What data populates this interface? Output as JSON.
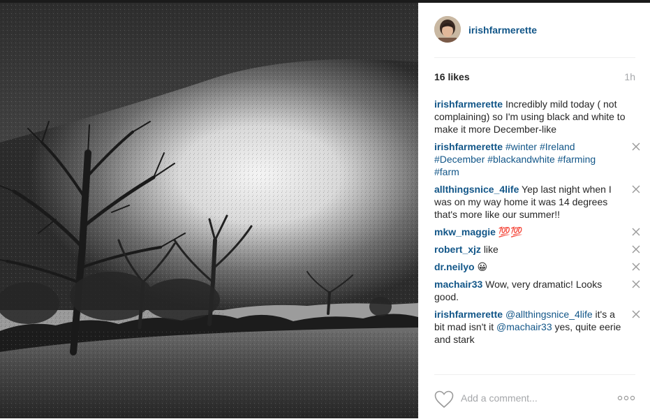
{
  "post": {
    "owner": "irishfarmerette",
    "likes": "16 likes",
    "time_ago": "1h"
  },
  "caption": {
    "user": "irishfarmerette",
    "text": "Incredibly mild today ( not complaining) so I'm using black and white to make it more December-like"
  },
  "comments": [
    {
      "user": "irishfarmerette",
      "parts": [
        {
          "t": "#winter",
          "tag": true
        },
        {
          "t": " "
        },
        {
          "t": "#Ireland",
          "tag": true
        },
        {
          "t": " "
        },
        {
          "t": "#December",
          "tag": true
        },
        {
          "t": " "
        },
        {
          "t": "#blackandwhite",
          "tag": true
        },
        {
          "t": " "
        },
        {
          "t": "#farming",
          "tag": true
        },
        {
          "t": " "
        },
        {
          "t": "#farm",
          "tag": true
        }
      ]
    },
    {
      "user": "allthingsnice_4life",
      "parts": [
        {
          "t": "Yep last night when I was on my way home it was 14 degrees that's more like our summer!!"
        }
      ]
    },
    {
      "user": "mkw_maggie",
      "parts": [
        {
          "t": "💯💯"
        }
      ]
    },
    {
      "user": "robert_xjz",
      "parts": [
        {
          "t": "like"
        }
      ]
    },
    {
      "user": "dr.neilyo",
      "parts": [
        {
          "t": "😀"
        }
      ]
    },
    {
      "user": "machair33",
      "parts": [
        {
          "t": "Wow, very dramatic! Looks good."
        }
      ]
    },
    {
      "user": "irishfarmerette",
      "parts": [
        {
          "t": "@allthingsnice_4life",
          "tag": true
        },
        {
          "t": " it's a bit mad isn't it "
        },
        {
          "t": "@machair33",
          "tag": true
        },
        {
          "t": " yes, quite eerie and stark"
        }
      ]
    }
  ],
  "footer": {
    "comment_placeholder": "Add a comment...",
    "icons": {
      "like": "heart-icon",
      "more": "more-options-icon",
      "delete": "close-icon"
    }
  },
  "colors": {
    "username": "#125688",
    "muted": "#a5a7aa",
    "text": "#262626",
    "divider": "#efefef"
  }
}
